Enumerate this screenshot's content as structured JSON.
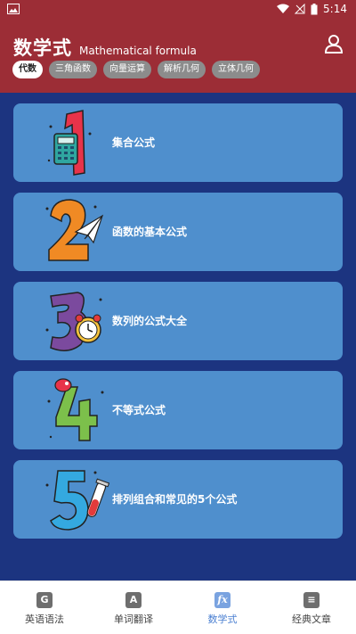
{
  "status_bar": {
    "time": "5:14"
  },
  "header": {
    "title": "数学式",
    "subtitle": "Mathematical formula"
  },
  "tabs": [
    {
      "label": "代数",
      "active": true
    },
    {
      "label": "三角函数",
      "active": false
    },
    {
      "label": "向量运算",
      "active": false
    },
    {
      "label": "解析几何",
      "active": false
    },
    {
      "label": "立体几何",
      "active": false
    }
  ],
  "cards": [
    {
      "label": "集合公式",
      "icon": "number-1-calculator-illustration"
    },
    {
      "label": "函数的基本公式",
      "icon": "number-2-paper-plane-illustration"
    },
    {
      "label": "数列的公式大全",
      "icon": "number-3-alarm-clock-illustration"
    },
    {
      "label": "不等式公式",
      "icon": "number-4-illustration"
    },
    {
      "label": "排列组合和常见的5个公式",
      "icon": "number-5-test-tube-illustration"
    }
  ],
  "bottom_nav": [
    {
      "label": "英语语法",
      "icon_glyph": "G",
      "active": false
    },
    {
      "label": "单词翻译",
      "icon_glyph": "A",
      "active": false
    },
    {
      "label": "数学式",
      "icon_glyph": "fx",
      "active": true
    },
    {
      "label": "经典文章",
      "icon_glyph": "≡",
      "active": false
    }
  ],
  "colors": {
    "header": "#9c2d36",
    "background": "#1c3480",
    "card": "#4f8fcd",
    "active_nav": "#4a7fd1"
  }
}
